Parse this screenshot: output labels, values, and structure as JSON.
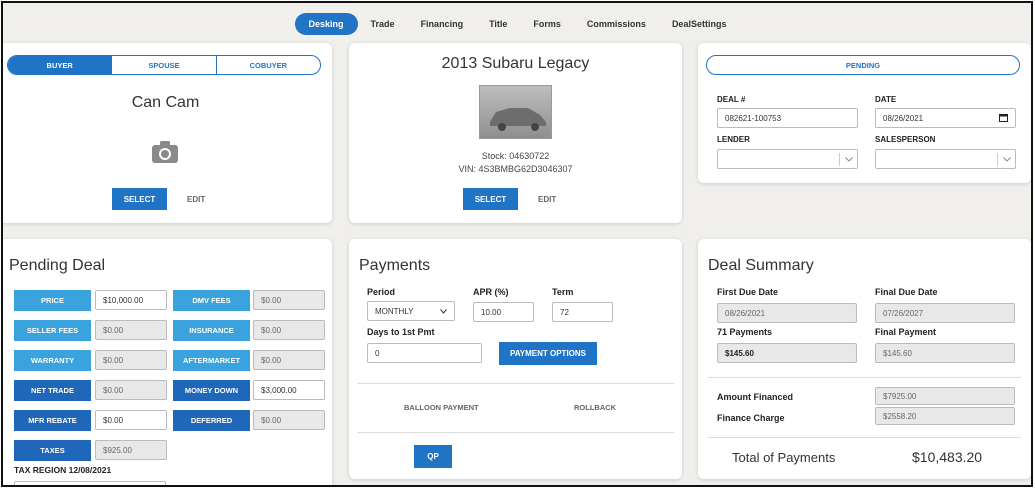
{
  "nav": {
    "tabs": [
      {
        "label": "Desking"
      },
      {
        "label": "Trade"
      },
      {
        "label": "Financing"
      },
      {
        "label": "Title"
      },
      {
        "label": "Forms"
      },
      {
        "label": "Commissions"
      },
      {
        "label": "DealSettings"
      }
    ],
    "active": "Desking"
  },
  "buyer": {
    "tabs": [
      "BUYER",
      "SPOUSE",
      "COBUYER"
    ],
    "name": "Can Cam",
    "select_label": "SELECT",
    "edit_label": "EDIT"
  },
  "vehicle": {
    "title": "2013 Subaru Legacy",
    "stock": "Stock: 04630722",
    "vin": "VIN: 4S3BMBG62D3046307",
    "select_label": "SELECT",
    "edit_label": "EDIT"
  },
  "deal_info": {
    "status": "PENDING",
    "deal_label": "DEAL #",
    "deal_value": "082621-100753",
    "date_label": "DATE",
    "date_value": "08/26/2021",
    "lender_label": "LENDER",
    "salesperson_label": "SALESPERSON"
  },
  "pending": {
    "title": "Pending Deal",
    "left": [
      {
        "label": "PRICE",
        "value": "$10,000.00",
        "editable": true
      },
      {
        "label": "SELLER FEES",
        "value": "$0.00",
        "editable": false
      },
      {
        "label": "WARRANTY",
        "value": "$0.00",
        "editable": false
      },
      {
        "label": "NET TRADE",
        "value": "$0.00",
        "editable": false
      },
      {
        "label": "MFR REBATE",
        "value": "$0.00",
        "editable": true
      },
      {
        "label": "TAXES",
        "value": "$925.00",
        "editable": false
      }
    ],
    "right": [
      {
        "label": "DMV FEES",
        "value": "$0.00",
        "editable": false
      },
      {
        "label": "INSURANCE",
        "value": "$0.00",
        "editable": false
      },
      {
        "label": "AFTERMARKET",
        "value": "$0.00",
        "editable": false
      },
      {
        "label": "MONEY DOWN",
        "value": "$3,000.00",
        "editable": true
      },
      {
        "label": "DEFERRED",
        "value": "$0.00",
        "editable": false
      }
    ],
    "tax_region": "TAX REGION 12/08/2021"
  },
  "payments": {
    "title": "Payments",
    "period_label": "Period",
    "period_value": "MONTHLY",
    "apr_label": "APR (%)",
    "apr_value": "10.00",
    "term_label": "Term",
    "term_value": "72",
    "days_label": "Days to 1st Pmt",
    "days_value": "0",
    "options_label": "PAYMENT OPTIONS",
    "balloon_label": "BALLOON PAYMENT",
    "rollback_label": "ROLLBACK",
    "qp_label": "QP"
  },
  "summary": {
    "title": "Deal Summary",
    "first_due_label": "First Due Date",
    "first_due_value": "08/26/2021",
    "final_due_label": "Final Due Date",
    "final_due_value": "07/26/2027",
    "payments_label": "71 Payments",
    "payments_value": "$145.60",
    "final_payment_label": "Final Payment",
    "final_payment_value": "$145.60",
    "amount_financed_label": "Amount Financed",
    "amount_financed_value": "$7925.00",
    "finance_charge_label": "Finance Charge",
    "finance_charge_value": "$2558.20",
    "total_label": "Total of Payments",
    "total_value": "$10,483.20"
  },
  "colors": {
    "accent": "#1f74c6",
    "light_button": "#3aa3dd",
    "dark_button": "#1f67b8",
    "background": "#f0efec"
  },
  "icons": {
    "camera": "camera-icon",
    "car_photo": "car-photo",
    "chevron": "chevron-down-icon",
    "calendar": "calendar-icon"
  }
}
